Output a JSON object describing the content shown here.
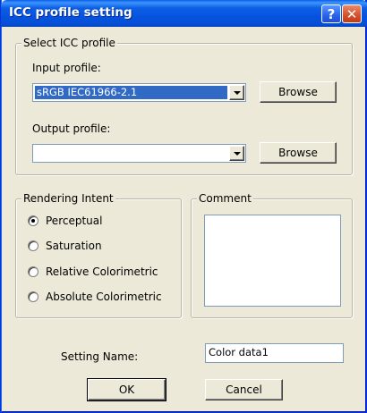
{
  "window": {
    "title": "ICC profile setting",
    "help_glyph": "?",
    "close_glyph": "✕"
  },
  "select_icc": {
    "group_label": "Select ICC profile",
    "input_label": "Input profile:",
    "input_value": "sRGB IEC61966-2.1",
    "input_browse": "Browse",
    "output_label": "Output profile:",
    "output_value": "",
    "output_browse": "Browse"
  },
  "rendering_intent": {
    "group_label": "Rendering Intent",
    "options": [
      "Perceptual",
      "Saturation",
      "Relative Colorimetric",
      "Absolute Colorimetric"
    ],
    "selected": "Perceptual"
  },
  "comment": {
    "group_label": "Comment",
    "value": ""
  },
  "setting": {
    "label": "Setting Name:",
    "value": "Color data1"
  },
  "buttons": {
    "ok": "OK",
    "cancel": "Cancel"
  },
  "colors": {
    "title_bar": "#0653e0",
    "dialog_bg": "#ece9d8",
    "selection": "#316ac5"
  }
}
